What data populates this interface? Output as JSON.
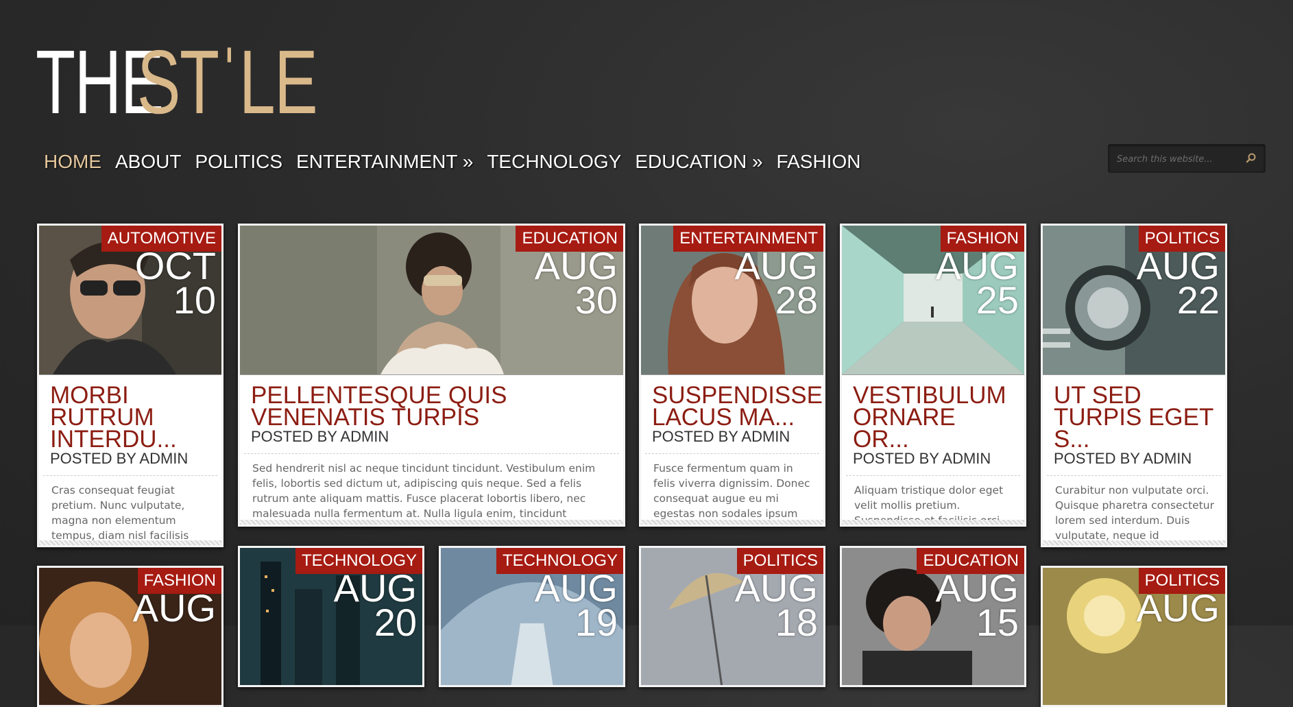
{
  "logo": {
    "part1": "THE",
    "part2": "STˈLE"
  },
  "nav": [
    {
      "label": "HOME",
      "active": true
    },
    {
      "label": "ABOUT"
    },
    {
      "label": "POLITICS"
    },
    {
      "label": "ENTERTAINMENT »"
    },
    {
      "label": "TECHNOLOGY"
    },
    {
      "label": "EDUCATION »"
    },
    {
      "label": "FASHION"
    }
  ],
  "search": {
    "placeholder": "Search this website...",
    "icon": "search-icon"
  },
  "posts": [
    {
      "category": "AUTOMOTIVE",
      "month": "OCT",
      "day": "10",
      "title": "MORBI RUTRUM INTERDU...",
      "byline": "POSTED BY ADMIN",
      "excerpt": "Cras consequat feugiat pretium. Nunc vulputate, magna non elementum tempus, diam nisl facilisis augue, ut lacinia quam"
    },
    {
      "category": "EDUCATION",
      "month": "AUG",
      "day": "30",
      "title": "PELLENTESQUE QUIS VENENATIS TURPIS",
      "byline": "POSTED BY ADMIN",
      "excerpt": "Sed hendrerit nisl ac neque tincidunt tincidunt. Vestibulum enim felis, lobortis sed dictum ut, adipiscing quis neque. Sed a felis rutrum ante aliquam mattis. Fusce placerat lobortis libero, nec malesuada nulla fermentum at. Nulla ligula enim, tincidunt interdum euismod sed,"
    },
    {
      "category": "ENTERTAINMENT",
      "month": "AUG",
      "day": "28",
      "title": "SUSPENDISSE LACUS MA...",
      "byline": "POSTED BY ADMIN",
      "excerpt": "Fusce fermentum quam in felis viverra dignissim. Donec consequat augue eu mi egestas non sodales ipsum scelerisque."
    },
    {
      "category": "FASHION",
      "month": "AUG",
      "day": "25",
      "title": "VESTIBULUM ORNARE OR...",
      "byline": "POSTED BY ADMIN",
      "excerpt": "Aliquam tristique dolor eget velit mollis pretium. Suspendisse et facilisis orci. Donec sed neque dolor. Aenean non elit lacus, eu"
    },
    {
      "category": "POLITICS",
      "month": "AUG",
      "day": "22",
      "title": "UT SED TURPIS EGET S...",
      "byline": "POSTED BY ADMIN",
      "excerpt": "Curabitur non vulputate orci. Quisque pharetra consectetur lorem sed interdum. Duis vulputate, neque id scelerisque"
    },
    {
      "category": "FASHION",
      "month": "AUG",
      "day": ""
    },
    {
      "category": "TECHNOLOGY",
      "month": "AUG",
      "day": "20"
    },
    {
      "category": "TECHNOLOGY",
      "month": "AUG",
      "day": "19"
    },
    {
      "category": "POLITICS",
      "month": "AUG",
      "day": "18"
    },
    {
      "category": "EDUCATION",
      "month": "AUG",
      "day": "15"
    },
    {
      "category": "POLITICS",
      "month": "AUG",
      "day": ""
    }
  ],
  "colors": {
    "accent": "#a61b12",
    "title": "#8c1d12",
    "nav_active": "#e6c89d",
    "logo_gold": "#d9b88a"
  }
}
